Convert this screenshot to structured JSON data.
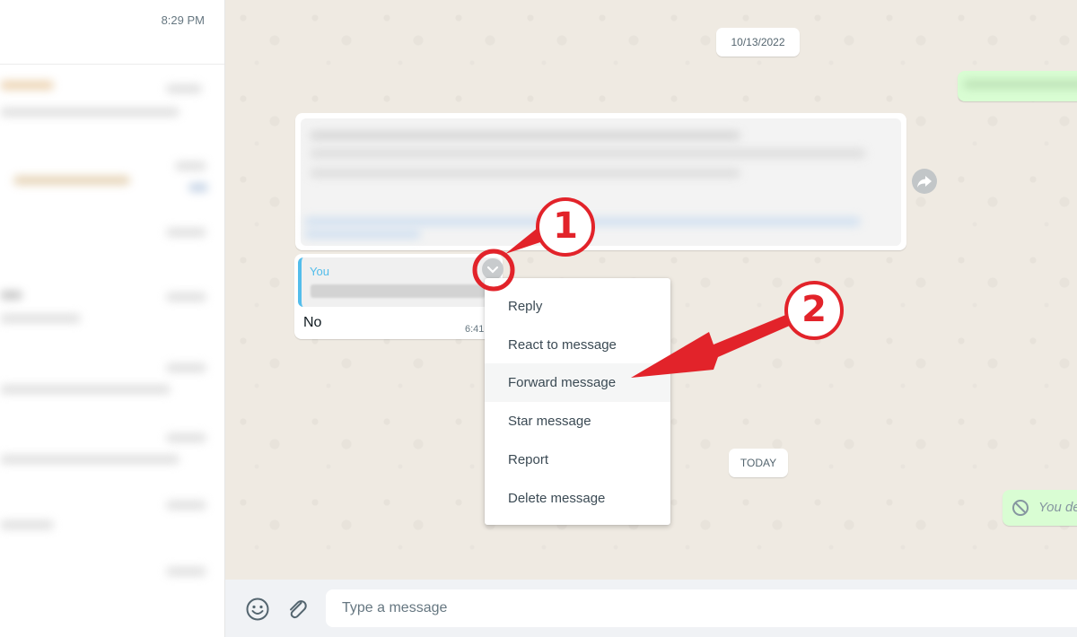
{
  "sidebar": {
    "top_time": "8:29 PM"
  },
  "chat": {
    "date_pill_1": "10/13/2022",
    "date_pill_2": "TODAY",
    "reply_bubble": {
      "quote_author": "You",
      "text": "No",
      "time": "6:41"
    },
    "deleted_notice": "You de"
  },
  "context_menu": {
    "items": [
      {
        "label": "Reply"
      },
      {
        "label": "React to message"
      },
      {
        "label": "Forward message"
      },
      {
        "label": "Star message"
      },
      {
        "label": "Report"
      },
      {
        "label": "Delete message"
      }
    ],
    "highlighted_item": "Forward message"
  },
  "composer": {
    "placeholder": "Type a message"
  },
  "annotations": {
    "step_1": "1",
    "step_2": "2",
    "color": "#e2232a"
  },
  "colors": {
    "accent_blue": "#53bdeb",
    "chat_bg": "#efeae2",
    "outgoing_bubble": "#d9fdd3",
    "annotation_red": "#e2232a"
  },
  "icons": [
    "emoji-icon",
    "attach-icon",
    "forward-share-icon",
    "chevron-down-icon",
    "blocked-icon"
  ]
}
